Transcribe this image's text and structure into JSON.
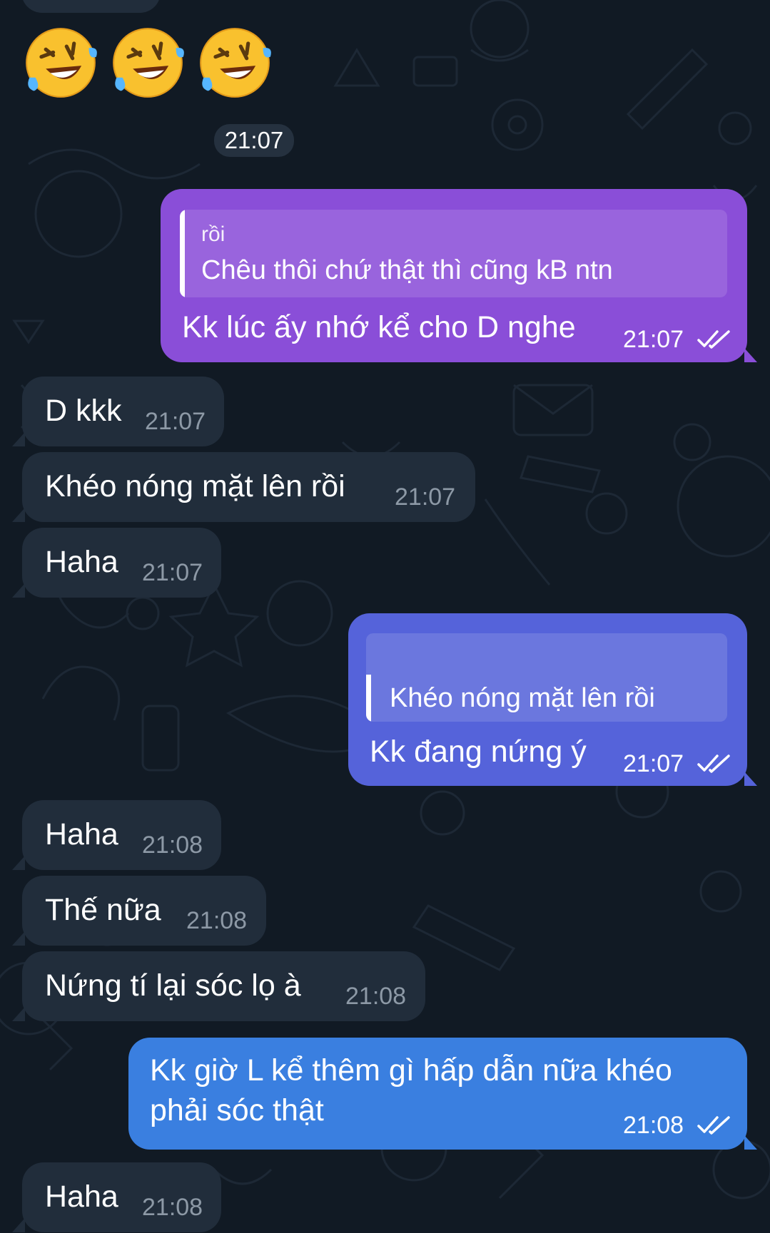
{
  "chat": {
    "emoji_reactions": [
      "rolling-on-floor-laughing",
      "rolling-on-floor-laughing",
      "rolling-on-floor-laughing"
    ],
    "emoji_time": "21:07",
    "messages": [
      {
        "dir": "out",
        "reply_author": "rồi",
        "reply_text": "Chêu thôi chứ thật thì cũng kB ntn",
        "text": "Kk lúc ấy nhớ kể cho D nghe",
        "time": "21:07",
        "status": "read"
      },
      {
        "dir": "in",
        "text": "D kkk",
        "time": "21:07"
      },
      {
        "dir": "in",
        "text": "Khéo nóng mặt lên rồi",
        "time": "21:07"
      },
      {
        "dir": "in",
        "text": "Haha",
        "time": "21:07"
      },
      {
        "dir": "out",
        "reply_author": "",
        "reply_text": "Khéo nóng mặt lên rồi",
        "text": "Kk đang nứng ý",
        "time": "21:07",
        "status": "read"
      },
      {
        "dir": "in",
        "text": "Haha",
        "time": "21:08"
      },
      {
        "dir": "in",
        "text": "Thế nữa",
        "time": "21:08"
      },
      {
        "dir": "in",
        "text": "Nứng tí lại sóc lọ à",
        "time": "21:08"
      },
      {
        "dir": "out",
        "text_line1": "Kk giờ L kể thêm gì hấp dẫn nữa khéo",
        "text_line2": "phải sóc thật",
        "time": "21:08",
        "status": "read"
      },
      {
        "dir": "in",
        "text": "Haha",
        "time": "21:08"
      }
    ]
  },
  "colors": {
    "background": "#111a24",
    "incoming_bubble": "#212d3b",
    "outgoing_bubble_1": "#8a4ed8",
    "outgoing_bubble_2": "#5563da",
    "outgoing_bubble_3": "#3a7fe0"
  }
}
